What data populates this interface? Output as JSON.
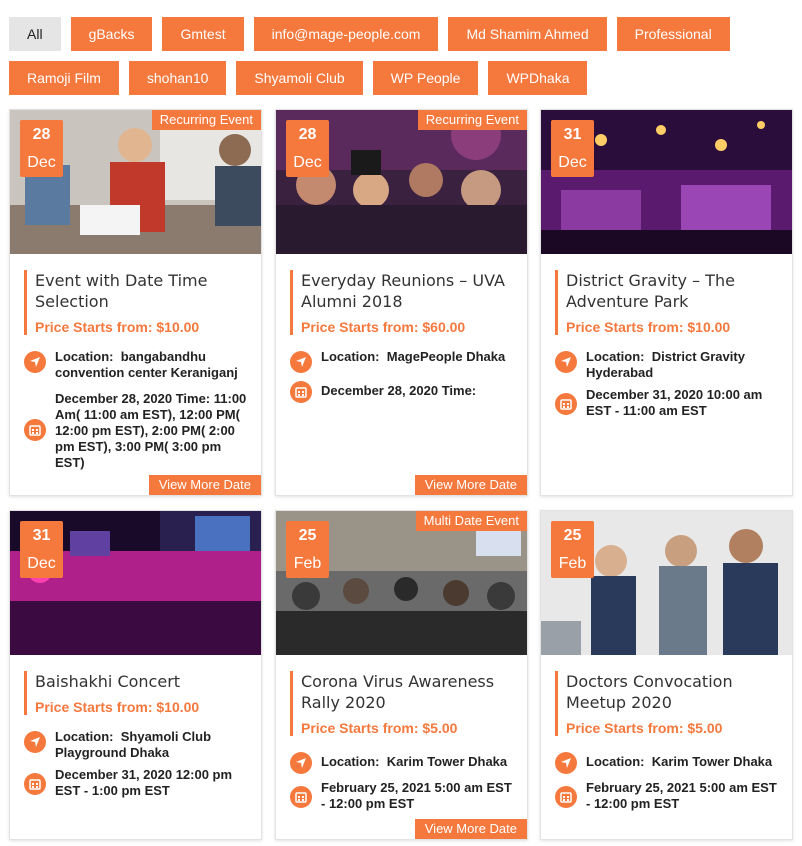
{
  "filters": [
    "All",
    "gBacks",
    "Gmtest",
    "info@mage-people.com",
    "Md Shamim Ahmed",
    "Professional",
    "Ramoji Film",
    "shohan10",
    "Shyamoli Club",
    "WP People",
    "WPDhaka"
  ],
  "active_filter": "All",
  "accent": "#f5783d",
  "location_prefix": "Location:",
  "events": [
    {
      "day": "28",
      "month": "Dec",
      "tag": "Recurring Event",
      "title": "Event with Date Time Selection",
      "price": "Price Starts from: $10.00",
      "location": "bangabandhu convention center Keraniganj",
      "datetime": "December 28, 2020 Time: 11:00 Am( 11:00 am EST), 12:00 PM( 12:00 pm EST), 2:00 PM( 2:00 pm EST), 3:00 PM( 3:00 pm EST)",
      "more": "View More Date"
    },
    {
      "day": "28",
      "month": "Dec",
      "tag": "Recurring Event",
      "title": "Everyday Reunions – UVA Alumni 2018",
      "price": "Price Starts from: $60.00",
      "location": "MagePeople Dhaka",
      "datetime": "December 28, 2020 Time:",
      "more": "View More Date"
    },
    {
      "day": "31",
      "month": "Dec",
      "tag": "",
      "title": "District Gravity – The Adventure Park",
      "price": "Price Starts from: $10.00",
      "location": "District Gravity Hyderabad",
      "datetime": "December 31, 2020  10:00 am EST - 11:00 am EST",
      "more": ""
    },
    {
      "day": "31",
      "month": "Dec",
      "tag": "",
      "title": "Baishakhi Concert",
      "price": "Price Starts from: $10.00",
      "location": "Shyamoli Club Playground Dhaka",
      "datetime": "December 31, 2020  12:00 pm EST - 1:00 pm EST",
      "more": ""
    },
    {
      "day": "25",
      "month": "Feb",
      "tag": "Multi Date Event",
      "title": "Corona Virus Awareness Rally 2020",
      "price": "Price Starts from: $5.00",
      "location": "Karim Tower Dhaka",
      "datetime": "February 25, 2021  5:00 am EST - 12:00 pm EST",
      "more": "View More Date"
    },
    {
      "day": "25",
      "month": "Feb",
      "tag": "",
      "title": "Doctors Convocation Meetup 2020",
      "price": "Price Starts from: $5.00",
      "location": "Karim Tower Dhaka",
      "datetime": "February 25, 2021  5:00 am EST - 12:00 pm EST",
      "more": ""
    }
  ]
}
